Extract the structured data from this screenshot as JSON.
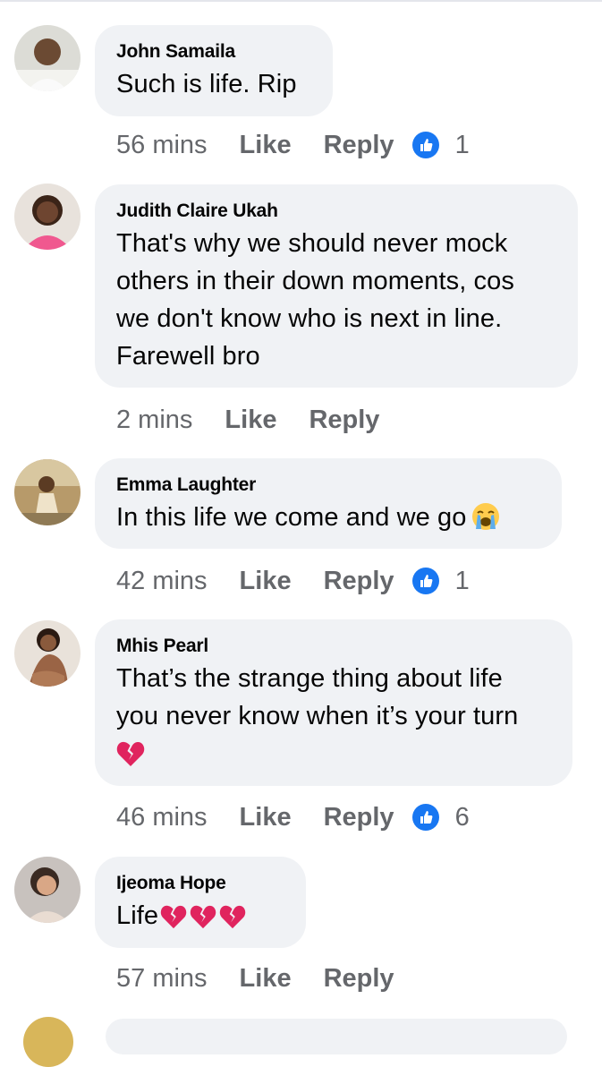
{
  "comments": [
    {
      "author": "John Samaila",
      "text": "Such is life. Rip",
      "time": "56 mins",
      "like_label": "Like",
      "reply_label": "Reply",
      "reaction_count": "1",
      "reaction_icon": "like-icon"
    },
    {
      "author": "Judith Claire Ukah",
      "text_lines": [
        "That's why we should never mock",
        "others in their down moments, cos",
        "we don't know who is next in line.",
        "Farewell bro"
      ],
      "time": "2 mins",
      "like_label": "Like",
      "reply_label": "Reply"
    },
    {
      "author": "Emma Laughter",
      "text": "In this life we come and we go",
      "emoji": "loudly-crying-face-emoji",
      "time": "42 mins",
      "like_label": "Like",
      "reply_label": "Reply",
      "reaction_count": "1",
      "reaction_icon": "like-icon"
    },
    {
      "author": "Mhis Pearl",
      "text_lines": [
        "That’s the strange thing about life",
        "you never know when it’s your turn"
      ],
      "emoji": "broken-heart-emoji",
      "time": "46 mins",
      "like_label": "Like",
      "reply_label": "Reply",
      "reaction_count": "6",
      "reaction_icon": "like-icon"
    },
    {
      "author": "Ijeoma Hope",
      "text": "Life",
      "emoji": "broken-heart-emoji x3",
      "time": "57 mins",
      "like_label": "Like",
      "reply_label": "Reply"
    }
  ],
  "colors": {
    "bubble": "#f0f2f5",
    "secondary_text": "#65676b",
    "like_blue": "#1877f2",
    "broken_heart": "#e0245e"
  }
}
